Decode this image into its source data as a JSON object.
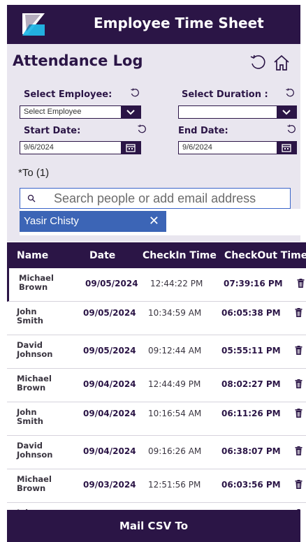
{
  "app": {
    "title": "Employee Time Sheet"
  },
  "page": {
    "title": "Attendance Log"
  },
  "filters": {
    "employee_label": "Select Employee:",
    "employee_value": "Select Employee",
    "duration_label": "Select Duration :",
    "duration_value": "",
    "start_label": "Start Date:",
    "start_value": "9/6/2024",
    "end_label": "End Date:",
    "end_value": "9/6/2024"
  },
  "mail": {
    "to_label": "*To (1)",
    "search_placeholder": "Search people or add email address",
    "recipients": [
      "Yasir Chisty"
    ]
  },
  "table": {
    "headers": [
      "Name",
      "Date",
      "CheckIn Time",
      "CheckOut Time"
    ],
    "rows": [
      {
        "name": "Michael Brown",
        "date": "09/05/2024",
        "checkin": "12:44:22 PM",
        "checkout": "07:39:16 PM"
      },
      {
        "name": "John Smith",
        "date": "09/05/2024",
        "checkin": "10:34:59 AM",
        "checkout": "06:05:38 PM"
      },
      {
        "name": "David Johnson",
        "date": "09/05/2024",
        "checkin": "09:12:44 AM",
        "checkout": "05:55:11 PM"
      },
      {
        "name": "Michael Brown",
        "date": "09/04/2024",
        "checkin": "12:44:49 PM",
        "checkout": "08:02:27 PM"
      },
      {
        "name": "John Smith",
        "date": "09/04/2024",
        "checkin": "10:16:54 AM",
        "checkout": "06:11:26 PM"
      },
      {
        "name": "David Johnson",
        "date": "09/04/2024",
        "checkin": "09:16:26 AM",
        "checkout": "06:38:07 PM"
      },
      {
        "name": "Michael Brown",
        "date": "09/03/2024",
        "checkin": "12:51:56 PM",
        "checkout": "06:03:56 PM"
      },
      {
        "name": "John Smith",
        "date": "",
        "checkin": "",
        "checkout": ""
      }
    ]
  },
  "footer": {
    "button_label": "Mail CSV To"
  },
  "colors": {
    "primary": "#2b1546",
    "panel": "#e9e6ef",
    "accent": "#3c65b6",
    "logo_cyan": "#22b8e8"
  }
}
